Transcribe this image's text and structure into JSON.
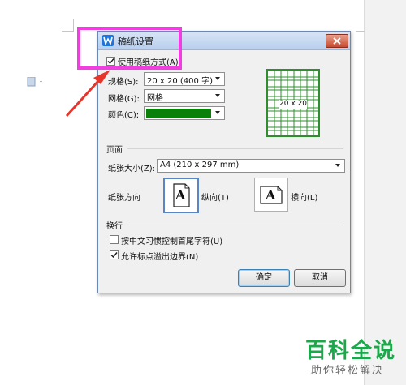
{
  "dialog": {
    "title": "稿纸设置",
    "use_manuscript_label": "使用稿纸方式(A)",
    "spec_label": "规格(S):",
    "spec_value": "20 x 20 (400 字)",
    "grid_label": "网格(G):",
    "grid_value": "网格",
    "color_label": "颜色(C):",
    "color_value": "#0a7f0a",
    "preview_text": "20 x 20",
    "page_section": "页面",
    "paper_size_label": "纸张大小(Z):",
    "paper_size_value": "A4 (210 x 297 mm)",
    "orientation_label": "纸张方向",
    "portrait_label": "纵向(T)",
    "landscape_label": "横向(L)",
    "line_break_section": "换行",
    "chinese_control_label": "按中文习惯控制首尾字符(U)",
    "allow_punct_label": "允许标点溢出边界(N)",
    "ok_label": "确定",
    "cancel_label": "取消",
    "orientation_glyph": "A"
  },
  "watermark": {
    "main": "百科全说",
    "sub": "助你轻松解决"
  },
  "colors": {
    "highlight": "#f03ee0",
    "arrow": "#e8352b",
    "grid_green": "#2f8f2f"
  }
}
